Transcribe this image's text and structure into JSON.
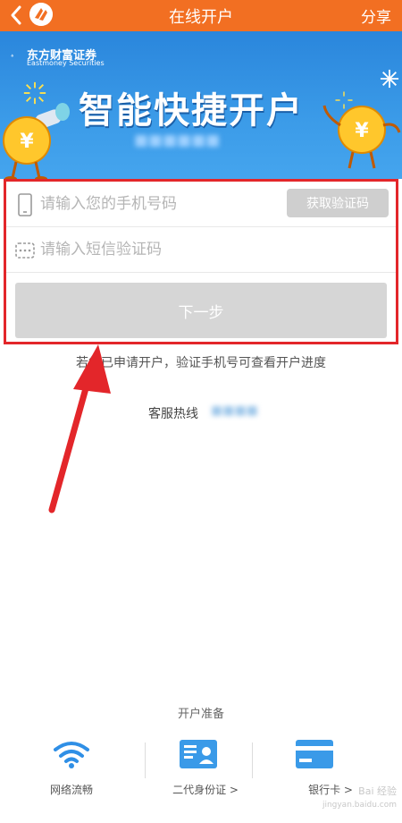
{
  "header": {
    "title": "在线开户",
    "share_label": "分享",
    "back_icon": "chevron-left-icon",
    "accent_color": "#f26f22"
  },
  "banner": {
    "brand_cn": "东方财富证券",
    "brand_en": "Eastmoney Securities",
    "headline": "智能快捷开户"
  },
  "form": {
    "phone_placeholder": "请输入您的手机号码",
    "code_placeholder": "请输入短信验证码",
    "get_code_label": "获取验证码",
    "next_label": "下一步"
  },
  "hint": "若您已申请开户，验证手机号可查看开户进度",
  "hotline": {
    "label": "客服热线"
  },
  "prep": {
    "title": "开户准备",
    "items": [
      {
        "label": "网络流畅",
        "icon": "wifi-icon"
      },
      {
        "label": "二代身份证 >",
        "icon": "id-card-icon"
      },
      {
        "label": "银行卡 >",
        "icon": "bank-card-icon"
      }
    ]
  },
  "watermark": {
    "line1": "Bai 经验",
    "line2": "jingyan.baidu.com"
  }
}
